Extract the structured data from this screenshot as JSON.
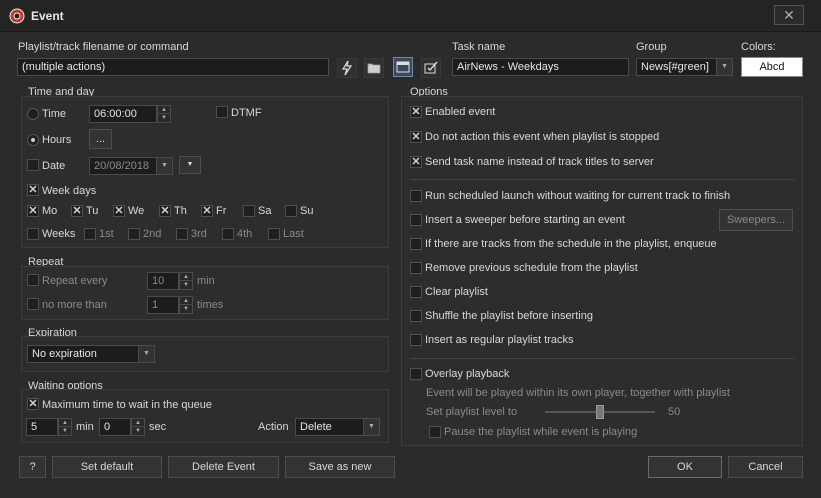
{
  "window": {
    "title": "Event",
    "close_label": "✕"
  },
  "top": {
    "playlist_label": "Playlist/track filename or command",
    "playlist_value": "(multiple actions)",
    "task_name_label": "Task name",
    "task_name_value": "AirNews - Weekdays",
    "group_label": "Group",
    "group_value": "News[#green]",
    "colors_label": "Colors:",
    "colors_value": "Abcd"
  },
  "time_and_day": {
    "title": "Time and day",
    "time_label": "Time",
    "time_value": "06:00:00",
    "dtmf_label": "DTMF",
    "hours_label": "Hours",
    "hours_button": "...",
    "date_label": "Date",
    "date_value": "20/08/2018",
    "week_days_label": "Week days",
    "days": [
      {
        "label": "Mo",
        "checked": true
      },
      {
        "label": "Tu",
        "checked": true
      },
      {
        "label": "We",
        "checked": true
      },
      {
        "label": "Th",
        "checked": true
      },
      {
        "label": "Fr",
        "checked": true
      },
      {
        "label": "Sa",
        "checked": false
      },
      {
        "label": "Su",
        "checked": false
      }
    ],
    "weeks_label": "Weeks",
    "weeks": [
      "1st",
      "2nd",
      "3rd",
      "4th",
      "Last"
    ]
  },
  "repeat": {
    "title": "Repeat",
    "repeat_every_label": "Repeat every",
    "repeat_every_value": "10",
    "repeat_unit": "min",
    "no_more_than_label": "no more than",
    "no_more_than_value": "1",
    "times_label": "times"
  },
  "expiration": {
    "title": "Expiration",
    "value": "No expiration"
  },
  "waiting": {
    "title": "Waiting options",
    "max_time_label": "Maximum time to wait in the queue",
    "min_value": "5",
    "min_label": "min",
    "sec_value": "0",
    "sec_label": "sec",
    "action_label": "Action",
    "action_value": "Delete"
  },
  "options": {
    "title": "Options",
    "enabled_event": "Enabled event",
    "no_action_stopped": "Do not action this event when playlist is stopped",
    "send_task_name": "Send task name instead of track titles to server",
    "run_without_waiting": "Run scheduled launch without waiting for current track to finish",
    "insert_sweeper": "Insert a sweeper before starting an event",
    "sweepers_button": "Sweepers...",
    "if_tracks_enqueue": "If there are tracks from the schedule in the playlist, enqueue",
    "remove_previous": "Remove previous schedule from the playlist",
    "clear_playlist": "Clear playlist",
    "shuffle_playlist": "Shuffle the playlist before inserting",
    "insert_regular": "Insert as regular playlist tracks",
    "overlay_playback": "Overlay playback",
    "overlay_desc": "Event will be played within its own player, together with playlist",
    "set_level_label": "Set playlist level to",
    "level_value": "50",
    "pause_playlist": "Pause the playlist while event is playing"
  },
  "footer": {
    "help": "?",
    "set_default": "Set default",
    "delete_event": "Delete Event",
    "save_as_new": "Save as new",
    "ok": "OK",
    "cancel": "Cancel"
  },
  "colors": {
    "accent_white": "#ffffff",
    "bg": "#2b2b2b"
  }
}
